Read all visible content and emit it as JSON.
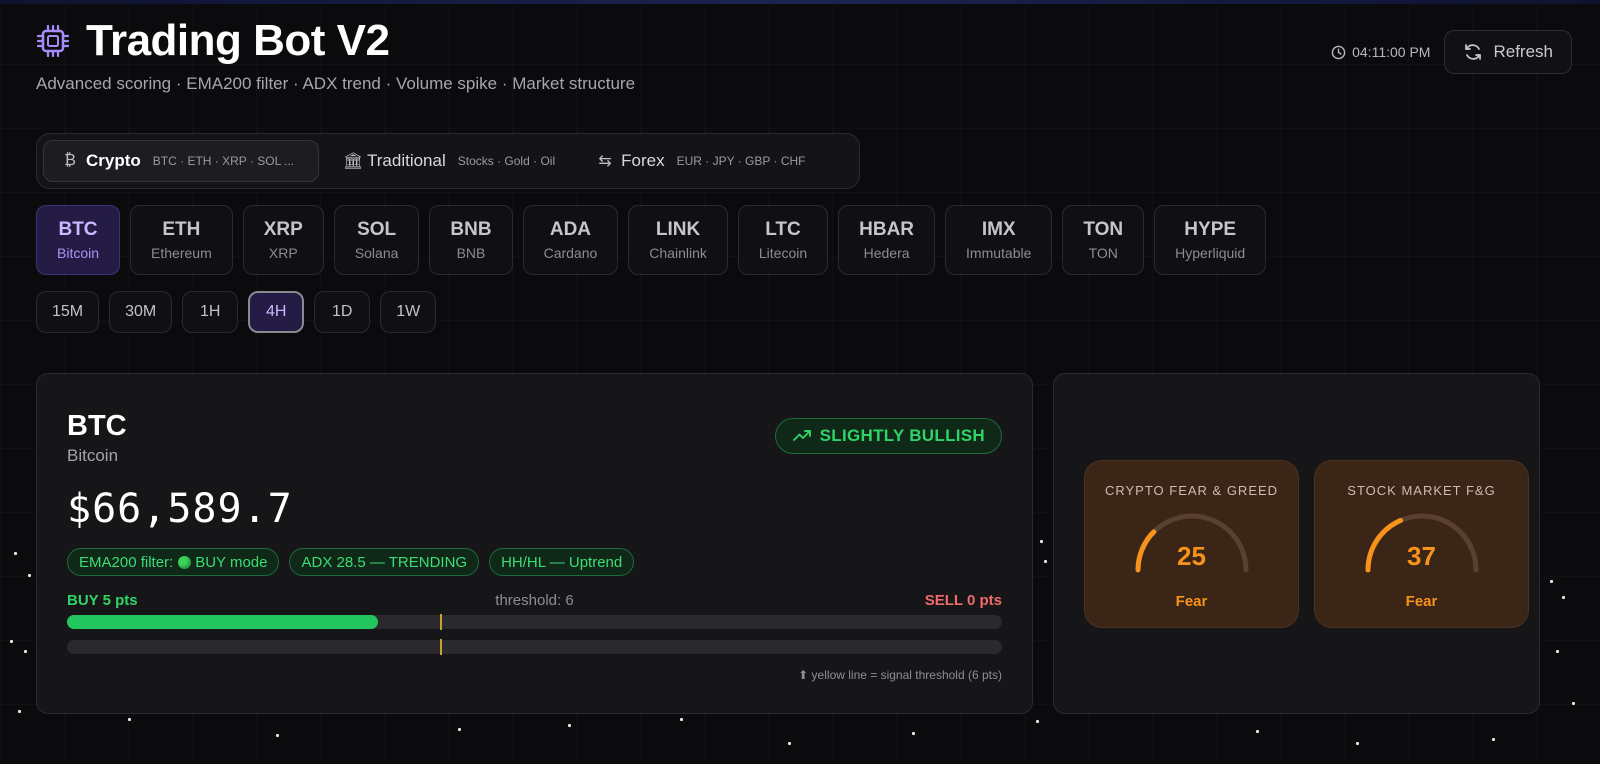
{
  "header": {
    "title": "Trading Bot V2",
    "subtitle": "Advanced scoring · EMA200 filter · ADX trend · Volume spike · Market structure",
    "time": "04:11:00 PM",
    "refresh_label": "Refresh"
  },
  "markets": [
    {
      "icon": "₿",
      "label": "Crypto",
      "sub": "BTC · ETH · XRP · SOL ..."
    },
    {
      "icon": "🏛",
      "label": "Traditional",
      "sub": "Stocks · Gold · Oil"
    },
    {
      "icon": "⇆",
      "label": "Forex",
      "sub": "EUR · JPY · GBP · CHF"
    }
  ],
  "coins": [
    {
      "sym": "BTC",
      "name": "Bitcoin"
    },
    {
      "sym": "ETH",
      "name": "Ethereum"
    },
    {
      "sym": "XRP",
      "name": "XRP"
    },
    {
      "sym": "SOL",
      "name": "Solana"
    },
    {
      "sym": "BNB",
      "name": "BNB"
    },
    {
      "sym": "ADA",
      "name": "Cardano"
    },
    {
      "sym": "LINK",
      "name": "Chainlink"
    },
    {
      "sym": "LTC",
      "name": "Litecoin"
    },
    {
      "sym": "HBAR",
      "name": "Hedera"
    },
    {
      "sym": "IMX",
      "name": "Immutable"
    },
    {
      "sym": "TON",
      "name": "TON"
    },
    {
      "sym": "HYPE",
      "name": "Hyperliquid"
    }
  ],
  "timeframes": [
    "15M",
    "30M",
    "1H",
    "4H",
    "1D",
    "1W"
  ],
  "active_timeframe": "4H",
  "asset": {
    "symbol": "BTC",
    "name": "Bitcoin",
    "price": "$66,589.7",
    "bias": "SLIGHTLY BULLISH",
    "pills": {
      "ema_prefix": "EMA200 filter:",
      "ema_mode": "BUY mode",
      "adx": "ADX 28.5 — TRENDING",
      "structure": "HH/HL — Uptrend"
    }
  },
  "score": {
    "buy_label": "BUY 5 pts",
    "sell_label": "SELL 0 pts",
    "threshold_label": "threshold: 6",
    "buy_fraction": 0.333,
    "sell_fraction": 0,
    "threshold_fraction": 0.4,
    "footnote": "⬆ yellow line = signal threshold (6 pts)"
  },
  "fear_greed": [
    {
      "label": "CRYPTO FEAR & GREED",
      "value": "25",
      "text": "Fear",
      "fraction": 0.25
    },
    {
      "label": "STOCK MARKET F&G",
      "value": "37",
      "text": "Fear",
      "fraction": 0.37
    }
  ],
  "colors": {
    "accent": "#c9b9ff",
    "bullish": "#2fd467",
    "bearish": "#f06a6a",
    "threshold": "#c9a227",
    "fear": "#f7931a"
  }
}
